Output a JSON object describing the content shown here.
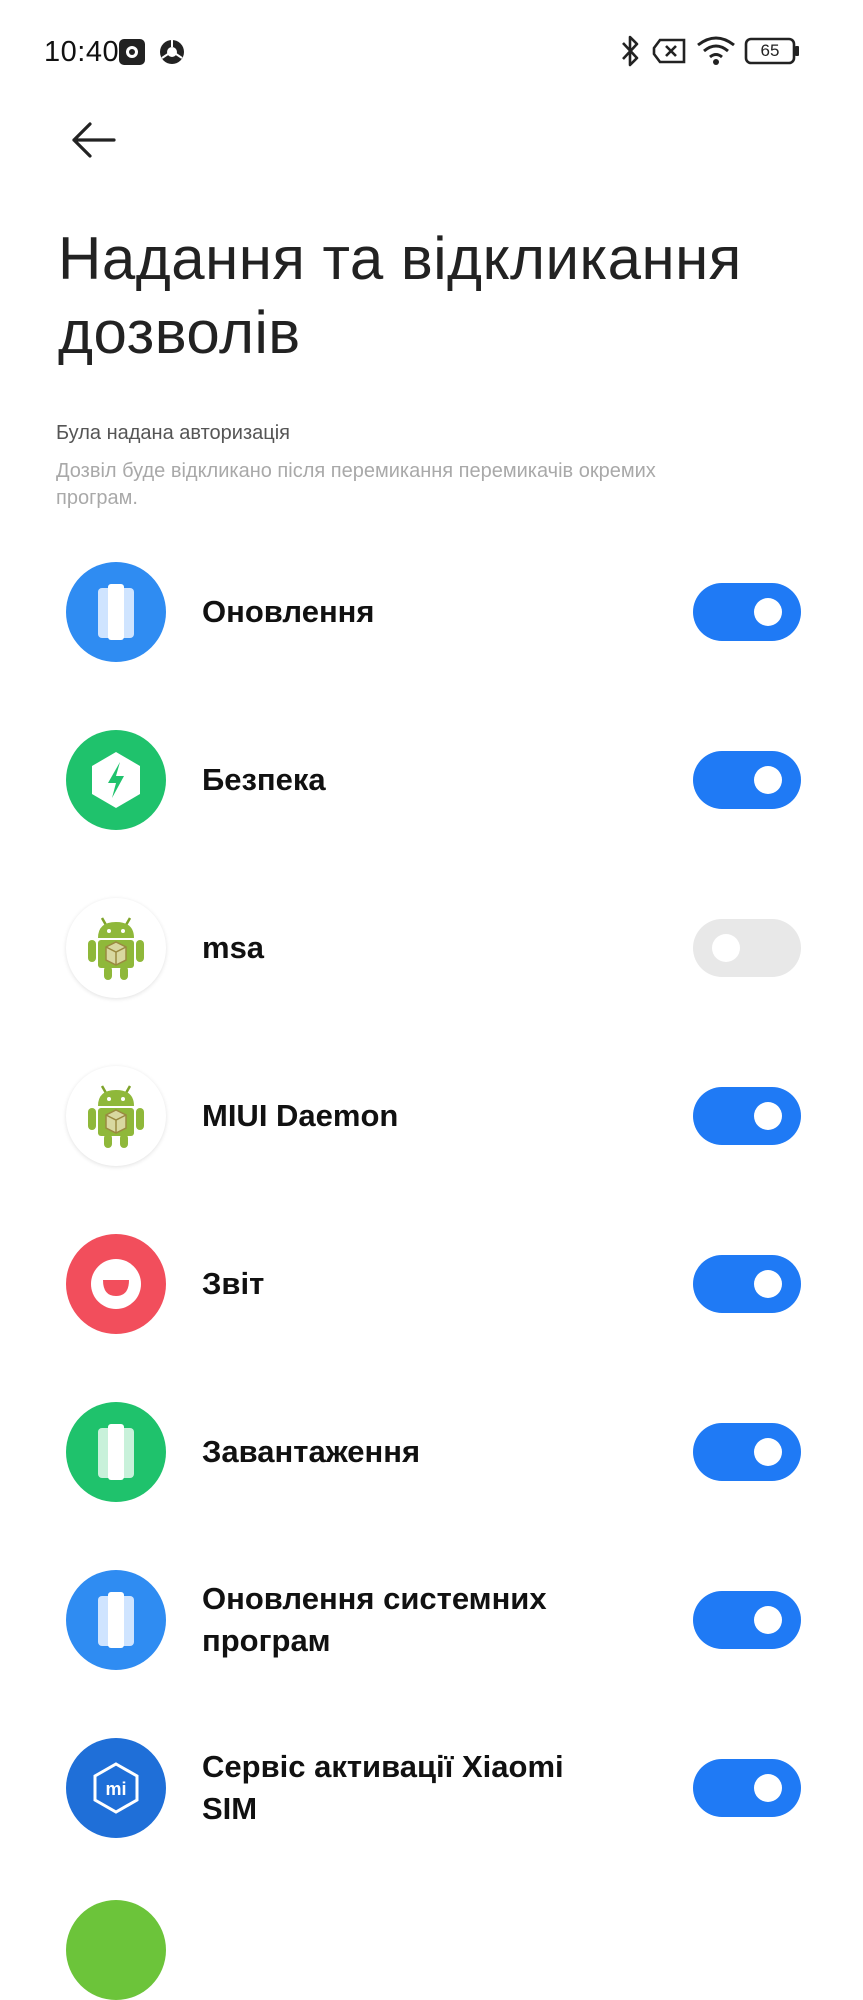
{
  "status_bar": {
    "time": "10:40",
    "battery": "65",
    "icons": [
      "screen-record-icon",
      "chrome-icon",
      "bluetooth-icon",
      "no-sim-icon",
      "wifi-icon",
      "battery-icon"
    ]
  },
  "header": {
    "back_icon": "back-arrow-icon",
    "title_line1": "Надання та відкликання",
    "title_line2": "дозволів"
  },
  "section": {
    "header": "Була надана авторизація",
    "description_line1": "Дозвіл буде відкликано після перемикання перемикачів окремих",
    "description_line2": "програм."
  },
  "apps": [
    {
      "name": "Оновлення",
      "icon": "updater-icon",
      "enabled": true
    },
    {
      "name": "Безпека",
      "icon": "security-icon",
      "enabled": true
    },
    {
      "name": "msa",
      "icon": "android-icon",
      "enabled": false
    },
    {
      "name": "MIUI Daemon",
      "icon": "android-icon",
      "enabled": true
    },
    {
      "name": "Звіт",
      "icon": "feedback-icon",
      "enabled": true
    },
    {
      "name": "Завантаження",
      "icon": "downloads-icon",
      "enabled": true
    },
    {
      "name_line1": "Оновлення системних",
      "name_line2": "програм",
      "icon": "system-updater-icon",
      "enabled": true
    },
    {
      "name_line1": "Сервіс активації Xiaomi",
      "name_line2": "SIM",
      "icon": "xiaomi-sim-icon",
      "enabled": true
    }
  ],
  "colors": {
    "toggle_on": "#1f7af5",
    "toggle_off": "#e8e8e8",
    "blue_icon": "#2f8cf2",
    "green_icon": "#1fc26c",
    "red_icon": "#f24e5c"
  }
}
